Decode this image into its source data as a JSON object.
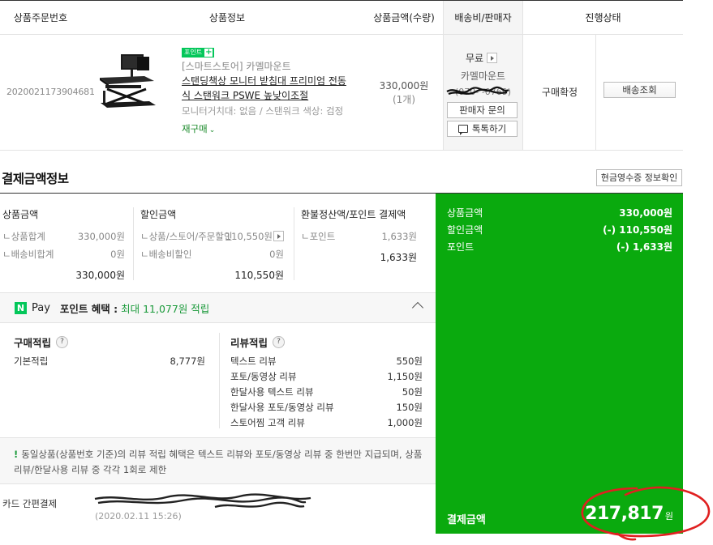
{
  "order_table": {
    "headers": {
      "order_no": "상품주문번호",
      "product_info": "상품정보",
      "price_qty": "상품금액(수량)",
      "shipping_seller": "배송비/판매자",
      "status": "진행상태"
    },
    "row": {
      "order_no": "2020021173904681",
      "point_badge": "포인트",
      "point_badge_plus": "+",
      "store": "[스마트스토어] 카멜마운트",
      "title": "스탠딩책상 모니터 받침대 프리미엄 전동식 스탠워크 PSWE 높낮이조절",
      "option": "모니터거치대: 없음 / 스탠워크 색상: 검정",
      "rebuy": "재구매",
      "rebuy_chevron": "⌄",
      "price": "330,000원",
      "qty": "(1개)",
      "shipping_fee": "무료",
      "seller_name": "카멜마운트",
      "seller_phone": "(070-   -0769)",
      "ask_seller": "판매자 문의",
      "talk": "톡톡하기",
      "status": "구매확정",
      "track": "배송조회"
    }
  },
  "payment": {
    "title": "결제금액정보",
    "receipt_button": "현금영수증 정보확인",
    "product_amount": {
      "head": "상품금액",
      "rows": [
        {
          "label": "ㄴ상품합계",
          "value": "330,000원"
        },
        {
          "label": "ㄴ배송비합계",
          "value": "0원"
        }
      ],
      "total": "330,000원"
    },
    "discount": {
      "head": "할인금액",
      "rows": [
        {
          "label": "ㄴ상품/스토어/주문할인",
          "value": "110,550원"
        },
        {
          "label": "ㄴ배송비할인",
          "value": "0원"
        }
      ],
      "total": "110,550원"
    },
    "refund_point": {
      "head": "환불정산액/포인트 결제액",
      "rows": [
        {
          "label": "ㄴ포인트",
          "value": "1,633원"
        }
      ],
      "total": "1,633원"
    },
    "summary": {
      "rows": [
        {
          "label": "상품금액",
          "value": "330,000원"
        },
        {
          "label": "할인금액",
          "value": "(-) 110,550원"
        },
        {
          "label": "포인트",
          "value": "(-) 1,633원"
        }
      ],
      "final_label": "결제금액",
      "final_value": "217,817",
      "final_unit": "원"
    },
    "method": "카드 간편결제",
    "paid_at": "(2020.02.11 15:26)"
  },
  "npay": {
    "logo": "N",
    "pay_word": "Pay",
    "benefit_label": "포인트 혜택 :",
    "benefit_value": "최대 11,077원 적립",
    "purchase": {
      "head": "구매적립",
      "rows": [
        {
          "label": "기본적립",
          "value": "8,777원"
        }
      ]
    },
    "review": {
      "head": "리뷰적립",
      "rows": [
        {
          "label": "텍스트 리뷰",
          "value": "550원"
        },
        {
          "label": "포토/동영상 리뷰",
          "value": "1,150원"
        },
        {
          "label": "한달사용 텍스트 리뷰",
          "value": "50원"
        },
        {
          "label": "한달사용 포토/동영상 리뷰",
          "value": "150원"
        },
        {
          "label": "스토어찜 고객 리뷰",
          "value": "1,000원"
        }
      ]
    },
    "notice_mark": "!",
    "notice": "동일상품(상품번호 기준)의 리뷰 적립 혜택은 텍스트 리뷰와 포토/동영상 리뷰 중 한번만 지급되며, 상품리뷰/한달사용 리뷰 중 각각 1회로 제한"
  },
  "colors": {
    "brand_green": "#03c75a",
    "summary_green": "#0aaa0e",
    "annotation_red": "#e02020"
  }
}
